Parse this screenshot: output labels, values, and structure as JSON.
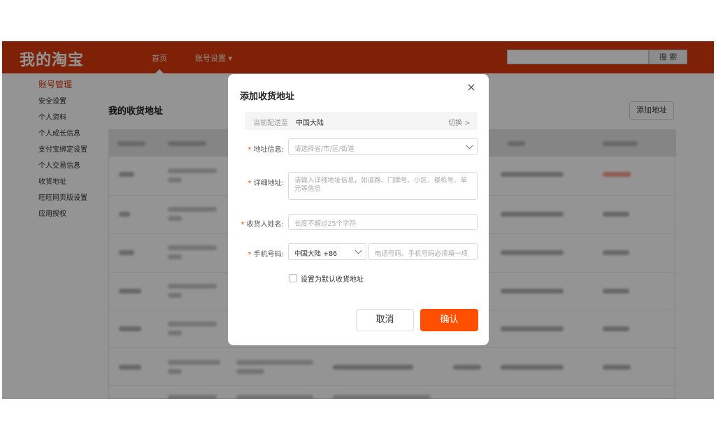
{
  "header": {
    "logo": "我的淘宝",
    "nav": [
      "首页",
      "账号设置 ▾"
    ],
    "search_button": "搜 索"
  },
  "sidebar": {
    "heading": "账号管理",
    "items": [
      "安全设置",
      "个人资料",
      "个人成长信息",
      "支付宝绑定设置",
      "个人交易信息",
      "收货地址",
      "旺旺网页版设置",
      "应用授权"
    ]
  },
  "content": {
    "title": "我的收货地址",
    "add_button": "添加地址"
  },
  "modal": {
    "title": "添加收货地址",
    "close": "×",
    "delivery_label": "当前配送至",
    "delivery_value": "中国大陆",
    "switch_link": "切换 >",
    "address_label": "地址信息:",
    "address_placeholder": "请选择省/市/区/街道",
    "detail_label": "详细地址:",
    "detail_placeholder": "请输入详细地址信息，如道路、门牌号、小区、楼栋号、单元等信息",
    "name_label": "收货人姓名:",
    "name_placeholder": "长度不超过25个字符",
    "phone_label": "手机号码:",
    "phone_region": "中国大陆 +86",
    "phone_placeholder": "电话号码、手机号码必须填一项",
    "default_label": "设置为默认收货地址",
    "cancel": "取消",
    "confirm": "确认"
  },
  "colors": {
    "brand": "#d93a0b",
    "primary_button": "#ff5000"
  }
}
